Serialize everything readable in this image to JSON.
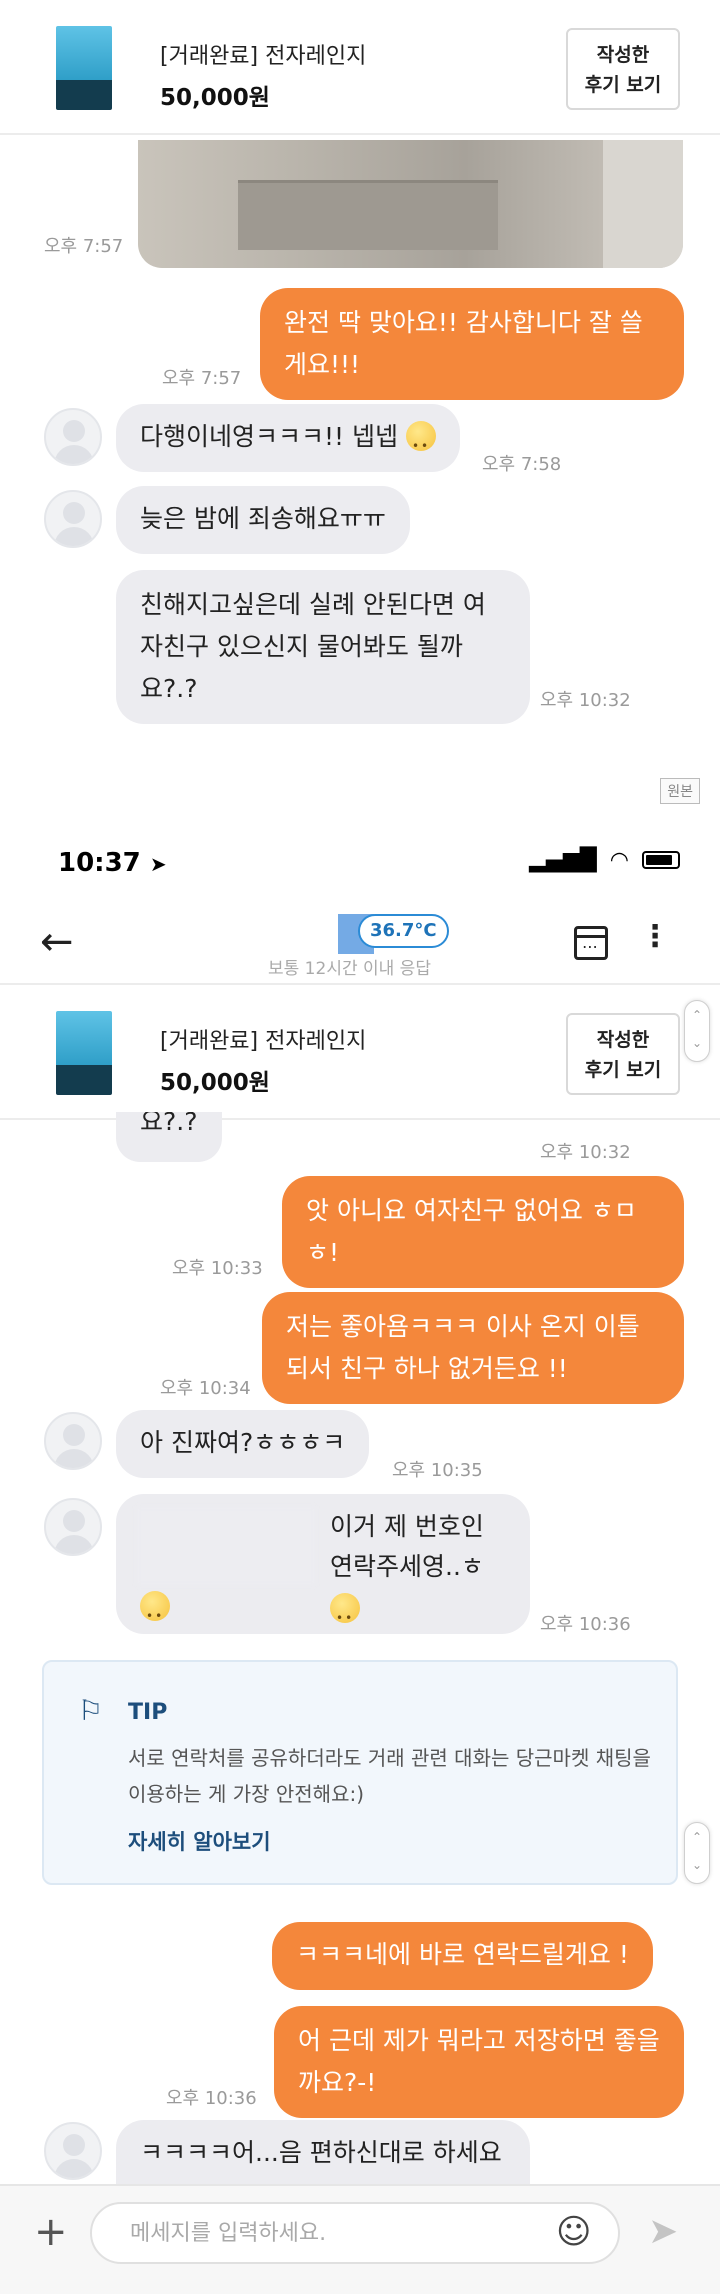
{
  "product": {
    "title": "[거래완료] 전자레인지",
    "price": "50,000원",
    "review_button": "작성한\n후기 보기"
  },
  "top_messages": [
    {
      "id": "t1",
      "time": "오후 7:57"
    },
    {
      "id": "m1",
      "text": "완전 딱 맞아요!! 감사합니다 잘 쓸게요!!!",
      "time": "오후 7:57"
    },
    {
      "id": "m2",
      "text": "다행이네영ㅋㅋㅋ!! 넵넵",
      "time": "오후 7:58"
    },
    {
      "id": "m3",
      "text": "늦은 밤에 죄송해요ㅠㅠ"
    },
    {
      "id": "m4",
      "text": "친해지고싶은데 실례 안된다면 여자친구 있으신지 물어봐도 될까요?.?",
      "time": "오후 10:32"
    }
  ],
  "original_badge": "원본",
  "status_bar": {
    "time": "10:37"
  },
  "nav": {
    "temperature": "36.7°C",
    "subtitle": "보통 12시간 이내 응답"
  },
  "bottom_messages": [
    {
      "id": "b0",
      "text": "요?.?",
      "time": "오후 10:32"
    },
    {
      "id": "b1",
      "text": "앗 아니요 여자친구 없어요 ㅎㅁㅎ!",
      "time": "오후 10:33"
    },
    {
      "id": "b2",
      "text": "저는 좋아욤ㅋㅋㅋ 이사 온지 이틀되서 친구 하나 없거든요 !!",
      "time": "오후 10:34"
    },
    {
      "id": "b3",
      "text": "아 진짜여?ㅎㅎㅎㅋ",
      "time": "오후 10:35"
    },
    {
      "id": "b4",
      "text_line1": "이거 제 번호인",
      "text_line2": "연락주세영..ㅎ",
      "time": "오후 10:36"
    },
    {
      "id": "b5",
      "text": "ㅋㅋㅋ네에 바로 연락드릴게요 !"
    },
    {
      "id": "b6",
      "text": "어 근데 제가 뭐라고 저장하면 좋을까요?-!",
      "time": "오후 10:36"
    },
    {
      "id": "b7",
      "text": "ㅋㅋㅋㅋ어...음 편하신대로 하세요"
    }
  ],
  "tip": {
    "title": "TIP",
    "body": "서로 연락처를 공유하더라도 거래 관련 대화는 당근마켓 채팅을 이용하는 게 가장 안전해요:)",
    "link": "자세히 알아보기"
  },
  "input": {
    "placeholder": "메세지를 입력하세요."
  },
  "colors": {
    "accent": "#f4873b",
    "tip_title": "#1d4e7c",
    "temperature": "#2b8bd6"
  }
}
